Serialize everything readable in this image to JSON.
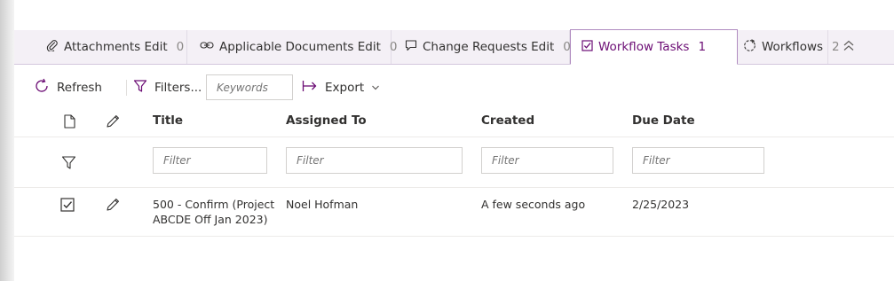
{
  "tabs": [
    {
      "label": "Attachments Edit",
      "count": "0",
      "icon": "paperclip-icon"
    },
    {
      "label": "Applicable Documents Edit",
      "count": "0",
      "icon": "link-icon"
    },
    {
      "label": "Change Requests Edit",
      "count": "0",
      "icon": "comment-icon"
    },
    {
      "label": "Workflow Tasks",
      "count": "1",
      "icon": "checkbox-icon",
      "active": true
    },
    {
      "label": "Workflows",
      "count": "2",
      "icon": "workflow-icon"
    }
  ],
  "toolbar": {
    "refresh_label": "Refresh",
    "filters_label": "Filters...",
    "keywords_placeholder": "Keywords",
    "export_label": "Export"
  },
  "grid": {
    "columns": [
      "Title",
      "Assigned To",
      "Created",
      "Due Date"
    ],
    "filter_placeholder": "Filter",
    "rows": [
      {
        "title_line1": "500 - Confirm (Project",
        "title_line2": "ABCDE Off Jan 2023)",
        "assigned_to": "Noel Hofman",
        "created": "A few seconds ago",
        "due_date": "2/25/2023"
      }
    ]
  },
  "colors": {
    "accent": "#6b0c74",
    "tabbar_bg": "#f4f0f6",
    "border": "#d2d0ce"
  }
}
